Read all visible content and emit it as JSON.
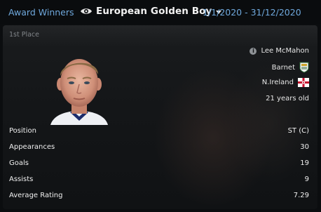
{
  "header": {
    "breadcrumb": "Award Winners",
    "award_name": "European Golden Boy",
    "date_range": "1/1/2020 - 31/12/2020"
  },
  "winner": {
    "place": "1st Place",
    "name": "Lee McMahon",
    "club": "Barnet",
    "nation": "N.Ireland",
    "age": "21 years old"
  },
  "stats": [
    {
      "label": "Position",
      "value": "ST (C)"
    },
    {
      "label": "Appearances",
      "value": "30"
    },
    {
      "label": "Goals",
      "value": "19"
    },
    {
      "label": "Assists",
      "value": "9"
    },
    {
      "label": "Average Rating",
      "value": "7.29"
    }
  ],
  "icons": {
    "view": "eye-icon",
    "dropdown": "chevron-down-icon",
    "info": "info-icon",
    "club": "barnet-crest-icon",
    "nation": "northern-ireland-flag-icon"
  },
  "colors": {
    "accent": "#6fa8dc",
    "background": "#0b0d0f",
    "panel": "#17191b"
  }
}
